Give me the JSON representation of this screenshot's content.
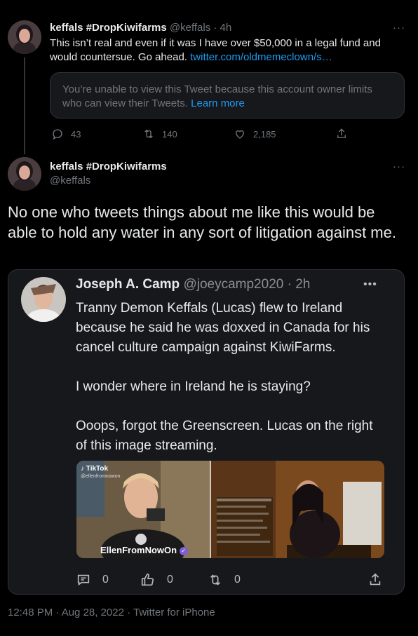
{
  "tweet1": {
    "display_name": "keffals #DropKiwifarms",
    "handle": "@keffals",
    "time": "· 4h",
    "more": "···",
    "text": "This isn’t real and even if it was I have over $50,000 in a legal fund and would countersue. Go ahead. ",
    "link": "twitter.com/oldmemeclown/s…",
    "notice_text": "You’re unable to view this Tweet because this account owner limits who can view their Tweets. ",
    "notice_link": "Learn more",
    "replies": "43",
    "retweets": "140",
    "likes": "2,185"
  },
  "tweet2": {
    "display_name": "keffals #DropKiwifarms",
    "handle": "@keffals",
    "more": "···",
    "text": "No one who tweets things about me like this would be able to hold any water in any sort of litigation against me.",
    "timestamp": "12:48 PM · Aug 28, 2022 · Twitter for iPhone"
  },
  "quoted": {
    "display_name": "Joseph A. Camp",
    "handle": "@joeycamp2020",
    "time": "· 2h",
    "more": "•••",
    "text_1": "Tranny Demon Keffals (Lucas) flew to Ireland because he said he was doxxed in Canada for his cancel culture campaign against KiwiFarms.",
    "text_2": "I wonder where in Ireland he is staying?",
    "text_3": "Ooops, forgot the Greenscreen. Lucas on the right of this image streaming.",
    "media": {
      "tiktok_label": "TikTok",
      "tiktok_handle": "@ellenfromnowon",
      "creator": "EllenFromNowOn"
    },
    "comments": "0",
    "likes": "0",
    "retweets": "0"
  },
  "colors": {
    "background": "#000000",
    "text": "#e7e9ea",
    "muted": "#71767b",
    "link": "#1d9bf0",
    "card_bg": "#16181c",
    "border": "#2f3336"
  }
}
